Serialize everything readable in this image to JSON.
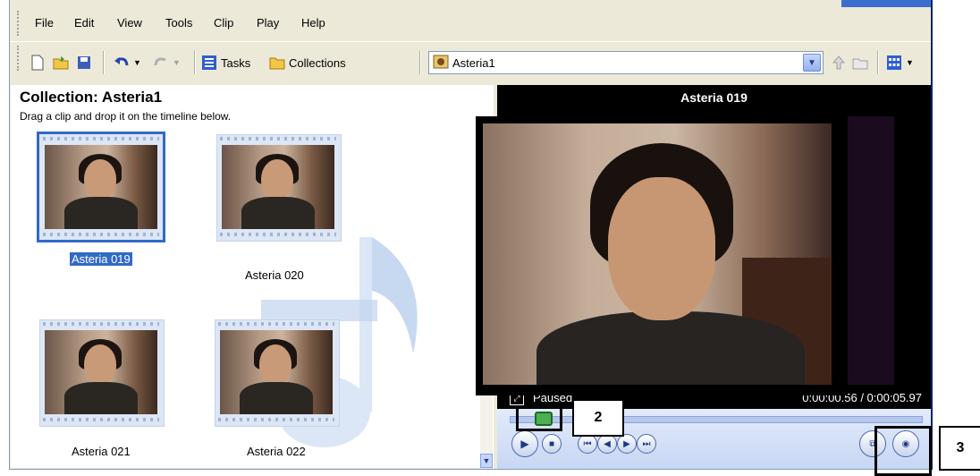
{
  "menu": [
    "File",
    "Edit",
    "View",
    "Tools",
    "Clip",
    "Play",
    "Help"
  ],
  "toolbar": {
    "tasks_label": "Tasks",
    "collections_label": "Collections",
    "collection_combo_value": "Asteria1"
  },
  "collection": {
    "title": "Collection: Asteria1",
    "instruction": "Drag a clip and drop it on the timeline below.",
    "clips": [
      {
        "label": "Asteria 019",
        "selected": true
      },
      {
        "label": "Asteria 020",
        "selected": false
      },
      {
        "label": "Asteria 021",
        "selected": false
      },
      {
        "label": "Asteria 022",
        "selected": false
      }
    ]
  },
  "monitor": {
    "title": "Asteria 019",
    "status": "Paused",
    "time": "0:00:00.56 / 0:00:05.97"
  },
  "callouts": {
    "two": "2",
    "three": "3"
  },
  "colors": {
    "selection": "#316ac5",
    "seek_thumb": "#4caf50",
    "monitor_bg": "#000000"
  }
}
